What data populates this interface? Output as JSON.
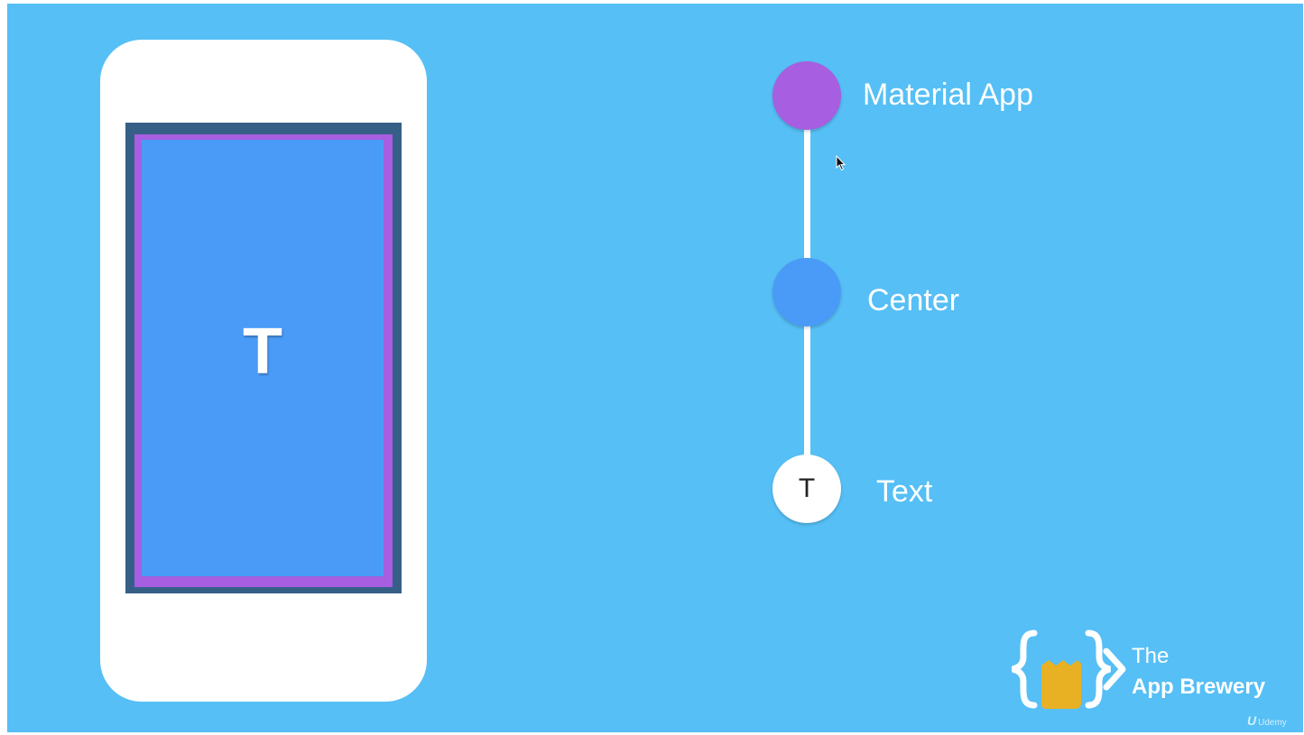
{
  "phone": {
    "screen_letter": "T"
  },
  "tree": {
    "nodes": [
      {
        "label": "Material App",
        "color": "#a75ee0"
      },
      {
        "label": "Center",
        "color": "#4a9bf7"
      },
      {
        "label": "Text",
        "color": "#ffffff",
        "glyph": "T"
      }
    ]
  },
  "logo": {
    "line1": "The",
    "line2": "App Brewery",
    "icon": "brackets-mug-logo",
    "mug_color": "#e8b023"
  },
  "watermark": {
    "mark": "U",
    "text": "Udemy"
  },
  "colors": {
    "background": "#56bff5",
    "phone_screen_outer": "#365f87",
    "phone_screen_purple": "#a75ee0",
    "phone_screen_blue": "#4a9bf7"
  }
}
